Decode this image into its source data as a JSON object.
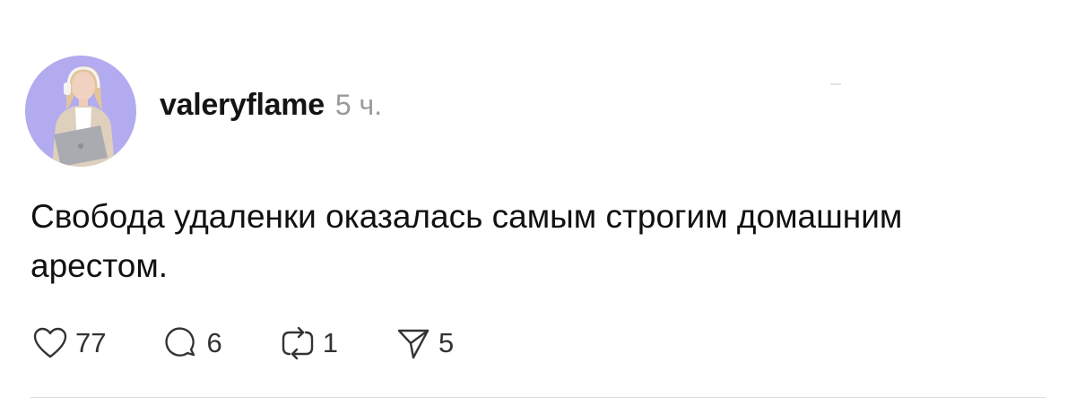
{
  "post": {
    "author": "valeryflame",
    "timestamp": "5 ч.",
    "text": "Свобода удаленки оказалась самым строгим домашним арестом."
  },
  "actions": {
    "likes": {
      "icon": "heart-icon",
      "count": "77"
    },
    "comments": {
      "icon": "comment-icon",
      "count": "6"
    },
    "reposts": {
      "icon": "repost-icon",
      "count": "1"
    },
    "shares": {
      "icon": "send-icon",
      "count": "5"
    }
  },
  "colors": {
    "avatar_bg": "#b3abef",
    "timestamp": "#9a9a9a",
    "icon_stroke": "#333333",
    "divider": "#dcdcdc"
  }
}
